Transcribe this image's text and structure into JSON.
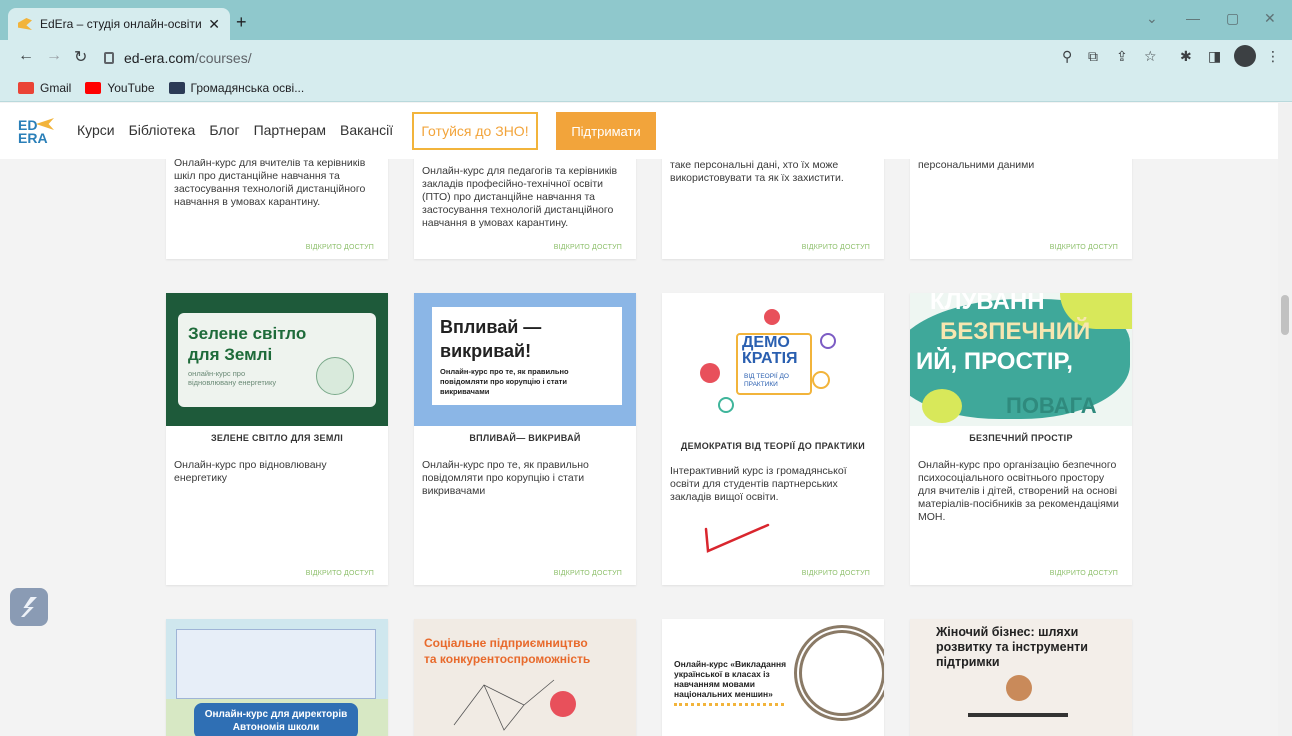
{
  "browser": {
    "tab_title": "EdEra – студія онлайн-освіти",
    "url_host": "ed-era.com",
    "url_path": "/courses/",
    "bookmarks": [
      {
        "label": "Gmail",
        "color": "#ea4335"
      },
      {
        "label": "YouTube",
        "color": "#ff0000"
      },
      {
        "label": "Громадянська осві...",
        "color": "#2b3a55"
      }
    ]
  },
  "site": {
    "logo_text_1": "ED",
    "logo_text_2": "ERA",
    "menu": [
      "Курси",
      "Бібліотека",
      "Блог",
      "Партнерам",
      "Вакансії"
    ],
    "btn_zno": "Готуйся до ЗНО!",
    "btn_support": "Підтримати",
    "access_label": "ВІДКРИТО ДОСТУП"
  },
  "row1": [
    {
      "desc": "Онлайн-курс для вчителів та керівників шкіл про дистанційне навчання та застосування технологій дистанційного навчання в умовах карантину."
    },
    {
      "desc": "Онлайн-курс для педагогів та керівників закладів професійно-технічної освіти (ПТО) про дистанційне навчання та застосування технологій дистанційного навчання в умовах карантину."
    },
    {
      "desc": "таке персональні дані, хто їх може використовувати та як їх захистити."
    },
    {
      "desc": "персональними даними"
    }
  ],
  "row2": [
    {
      "title": "ЗЕЛЕНЕ СВІТЛО ДЛЯ ЗЕМЛІ",
      "img_line1": "Зелене світло",
      "img_line2": "для Землі",
      "img_sub": "онлайн-курс про відновлювану енергетику",
      "desc": "Онлайн-курс про відновлювану енергетику"
    },
    {
      "title": "ВПЛИВАЙ— ВИКРИВАЙ",
      "img_line1": "Впливай —",
      "img_line2": "викривай!",
      "img_sub": "Онлайн-курс про те, як правильно повідомляти про корупцію і стати викривачами",
      "desc": "Онлайн-курс про те, як правильно повідомляти про корупцію і стати викривачами"
    },
    {
      "title": "ДЕМОКРАТІЯ ВІД ТЕОРІЇ ДО ПРАКТИКИ",
      "img_line1": "ДЕМО",
      "img_line2": "КРАТІЯ",
      "img_sub": "ВІД ТЕОРІЇ ДО ПРАКТИКИ",
      "desc": "Інтерактивний курс із громадянської освіти для студентів партнерських закладів вищої освіти."
    },
    {
      "title": "БЕЗПЕЧНИЙ ПРОСТІР",
      "img_line1": "КЛУВАНН",
      "img_line2": "БЕЗПЕЧНИЙ",
      "img_line3": "ИЙ, ПРОСТІР,",
      "img_line4": "ПОВАГА",
      "desc": "Онлайн-курс про організацію безпечного психосоціального освітнього простору для вчителів і дітей, створений на основі матеріалів-посібників за рекомендаціями МОН."
    }
  ],
  "row3": [
    {
      "img_caption_1": "Онлайн-курс для директорів",
      "img_caption_2": "Автономія школи"
    },
    {
      "img_caption_1": "Соціальне підприємництво",
      "img_caption_2": "та конкурентоспроможність"
    },
    {
      "img_caption_1": "Онлайн-курс «Викладання української в класах із навчанням мовами національних меншин»"
    },
    {
      "img_caption_1": "Жіночий бізнес: шляхи розвитку та інструменти підтримки"
    }
  ]
}
